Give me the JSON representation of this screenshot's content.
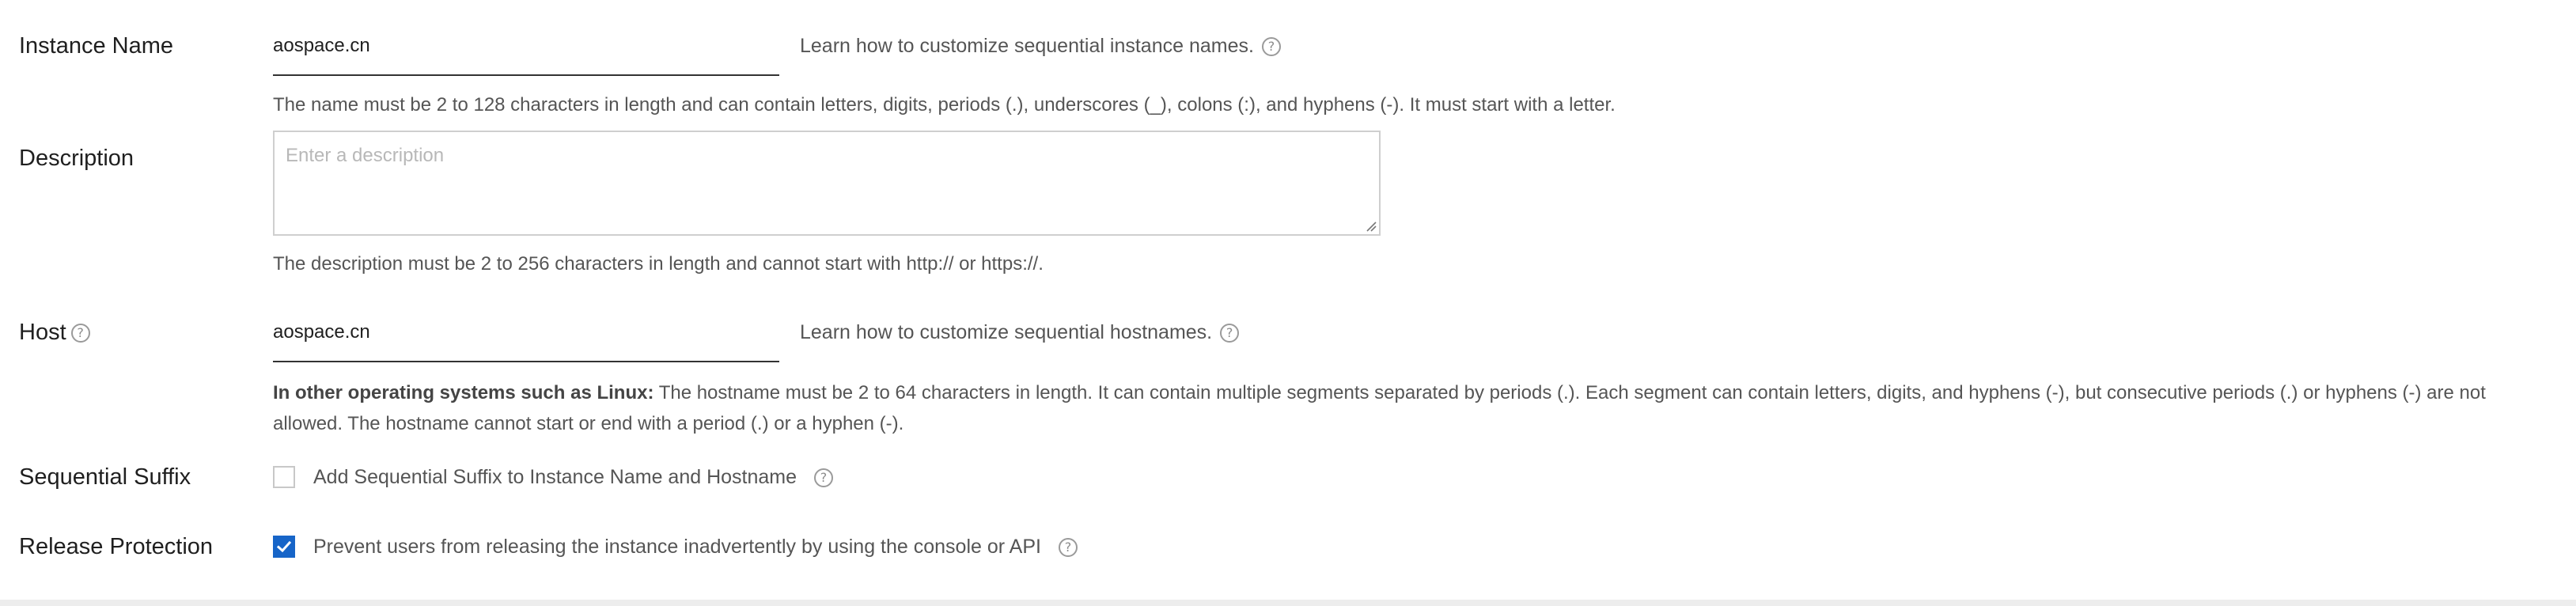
{
  "instance_name": {
    "label": "Instance Name",
    "value": "aospace.cn",
    "learn_link": "Learn how to customize sequential instance names.",
    "hint": "The name must be 2 to 128 characters in length and can contain letters, digits, periods (.), underscores (_), colons (:), and hyphens (-). It must start with a letter."
  },
  "description": {
    "label": "Description",
    "placeholder": "Enter a description",
    "hint": "The description must be 2 to 256 characters in length and cannot start with http:// or https://."
  },
  "host": {
    "label": "Host",
    "value": "aospace.cn",
    "learn_link": "Learn how to customize sequential hostnames.",
    "hint_bold": "In other operating systems such as Linux:",
    "hint": " The hostname must be 2 to 64 characters in length. It can contain multiple segments separated by periods (.). Each segment can contain letters, digits, and hyphens (-), but consecutive periods (.) or hyphens (-) are not allowed. The hostname cannot start or end with a period (.) or a hyphen (-)."
  },
  "sequential_suffix": {
    "label": "Sequential Suffix",
    "checkbox_label": "Add Sequential Suffix to Instance Name and Hostname",
    "checked": false
  },
  "release_protection": {
    "label": "Release Protection",
    "checkbox_label": "Prevent users from releasing the instance inadvertently by using the console or API",
    "checked": true
  },
  "icons": {
    "help": "question-circle-icon",
    "check": "checkmark-icon"
  },
  "colors": {
    "accent": "#1765c8",
    "text_primary": "#1f1f1f",
    "text_secondary": "#555555",
    "placeholder": "#b8b8b8"
  }
}
